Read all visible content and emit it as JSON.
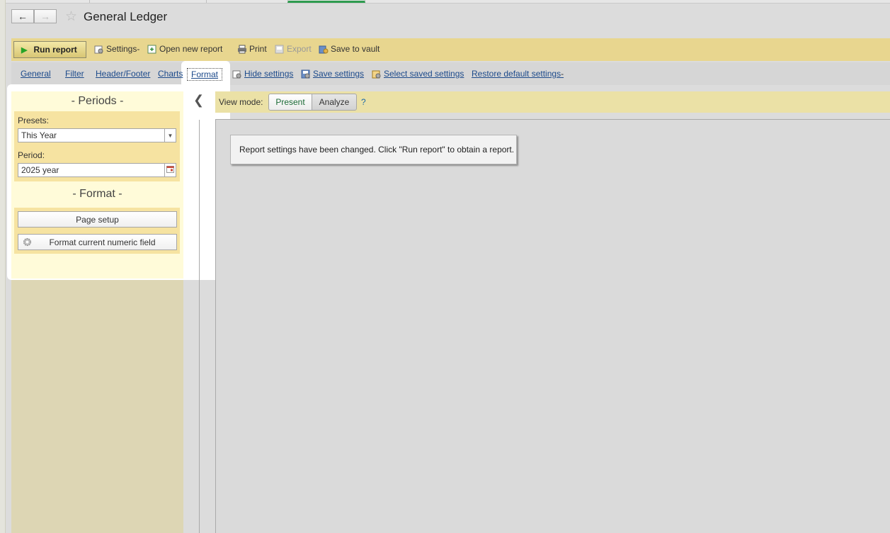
{
  "window": {
    "title": "General Ledger"
  },
  "commands": {
    "run_report": "Run report",
    "settings": "Settings",
    "open_new_report": "Open new report",
    "print": "Print",
    "export": "Export",
    "save_to_vault": "Save to vault"
  },
  "settings_tabs": {
    "general": "General",
    "filter": "Filter",
    "header_footer": "Header/Footer",
    "charts": "Charts",
    "format": "Format",
    "hide_settings": "Hide settings",
    "save_settings": "Save settings",
    "select_saved_settings": "Select saved settings",
    "restore_default_settings": "Restore default settings"
  },
  "periods": {
    "heading": "- Periods -",
    "presets_label": "Presets:",
    "presets_value": "This Year",
    "period_label": "Period:",
    "period_value": "2025 year"
  },
  "format": {
    "heading": "- Format -",
    "page_setup": "Page setup",
    "format_numeric": "Format current numeric field"
  },
  "view_mode": {
    "label": "View mode:",
    "present": "Present",
    "analyze": "Analyze",
    "help": "?"
  },
  "notice": "Report settings have been changed. Click \"Run report\" to obtain a report.",
  "colors": {
    "command_bar": "#e8d68f",
    "panel_highlight": "#fffbd9",
    "link": "#1c4a8b",
    "present_text": "#1b6a35"
  }
}
